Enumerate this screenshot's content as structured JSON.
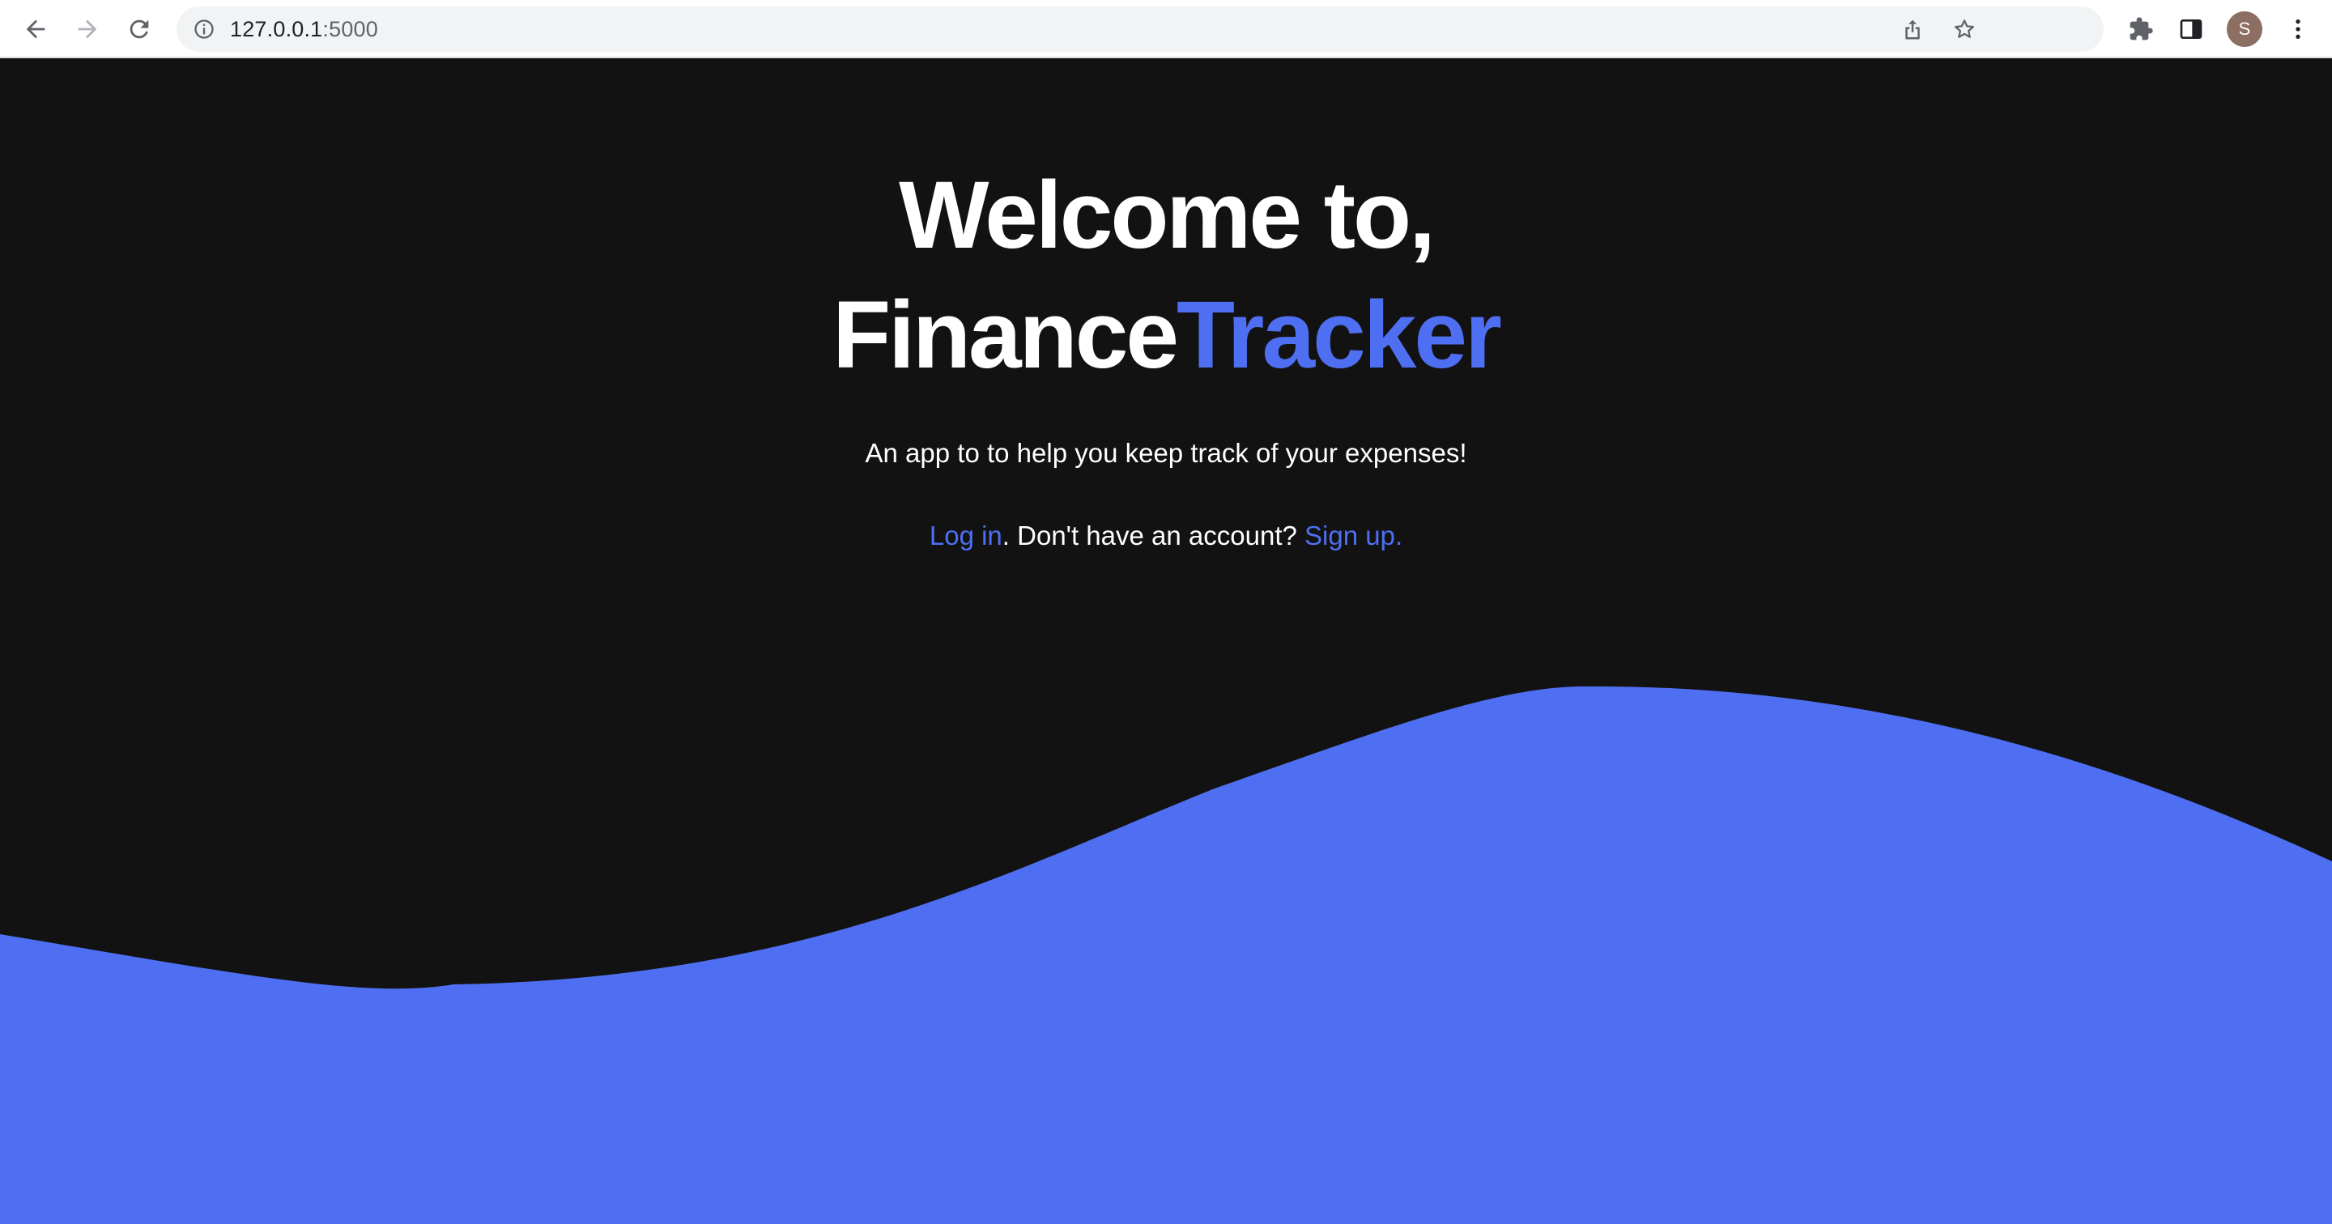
{
  "browser": {
    "url_host": "127.0.0.1",
    "url_port": ":5000",
    "profile_initial": "S",
    "icons": {
      "back": "arrow-left-icon",
      "forward": "arrow-right-icon",
      "reload": "reload-icon",
      "site_info": "info-icon",
      "share": "share-icon",
      "bookmark": "star-icon",
      "extensions": "puzzle-icon",
      "side_panel": "side-panel-icon",
      "menu": "kebab-menu-icon"
    }
  },
  "hero": {
    "heading_line1": "Welcome to,",
    "brand_part1": "Finance",
    "brand_part2": "Tracker",
    "tagline": "An app to to help you keep track of your expenses!",
    "login_label": "Log in",
    "signup_prompt": ". Don't have an account? ",
    "signup_label": "Sign up."
  },
  "colors": {
    "background": "#121212",
    "accent": "#4f6ff2",
    "text": "#ffffff"
  }
}
